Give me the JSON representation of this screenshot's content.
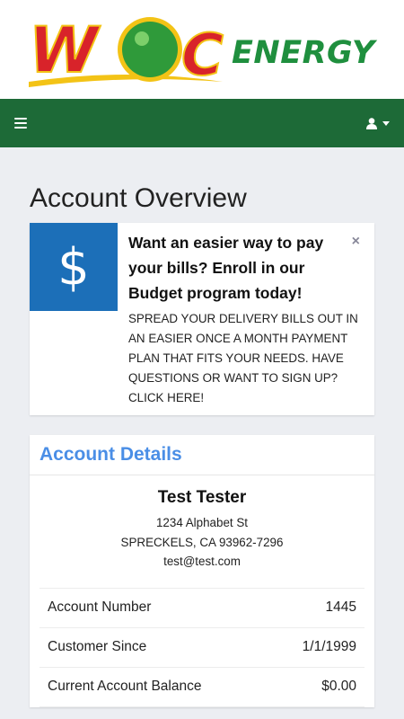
{
  "logo": {
    "brand_letters": "WOC",
    "brand_word": "ENERGY",
    "colors": {
      "red": "#d8232a",
      "yellow": "#f3c316",
      "green": "#2f9a3a",
      "dark_green": "#1d6a37"
    }
  },
  "navbar": {
    "menu_icon": "hamburger-icon",
    "user_icon": "user-icon",
    "background": "#1d6a37"
  },
  "page": {
    "title": "Account Overview"
  },
  "promo": {
    "icon": "dollar-icon",
    "icon_glyph": "$",
    "headline": "Want an easier way to pay your bills? Enroll in our Budget program today!",
    "text": "SPREAD YOUR DELIVERY BILLS OUT IN AN EASIER ONCE A MONTH PAYMENT PLAN THAT FITS YOUR NEEDS. HAVE QUESTIONS OR WANT TO SIGN UP? CLICK HERE!",
    "close_glyph": "×"
  },
  "account": {
    "header": "Account Details",
    "name": "Test Tester",
    "address1": "1234 Alphabet St",
    "address2": "SPRECKELS, CA 93962-7296",
    "email": "test@test.com",
    "rows": [
      {
        "label": "Account Number",
        "value": "1445"
      },
      {
        "label": "Customer Since",
        "value": "1/1/1999"
      },
      {
        "label": "Current Account Balance",
        "value": "$0.00"
      }
    ]
  }
}
